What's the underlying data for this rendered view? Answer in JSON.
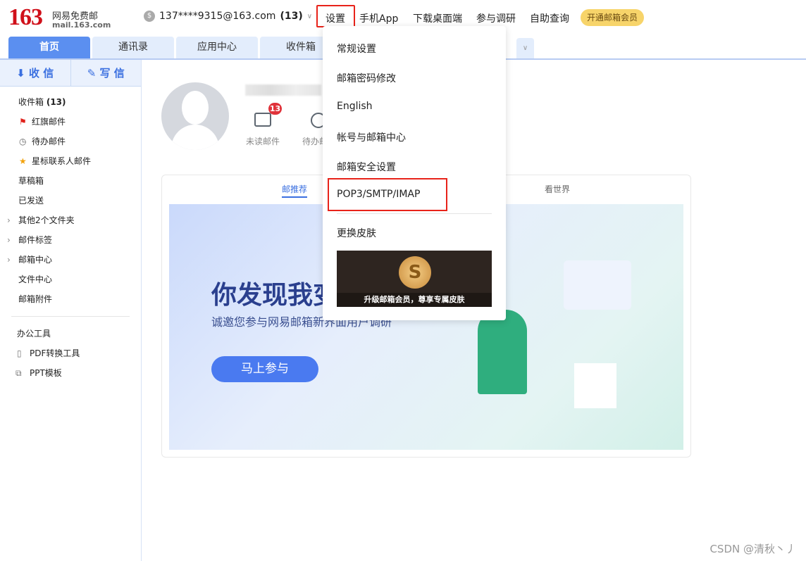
{
  "header": {
    "logo_number": "163",
    "logo_cn": "网易免费邮",
    "logo_domain": "mail.163.com",
    "account": "137****9315@163.com",
    "unread_count": "(13)",
    "nav": [
      "设置",
      "手机App",
      "下载桌面端",
      "参与调研",
      "自助查询"
    ],
    "vip_button": "开通邮箱会员"
  },
  "tabs": [
    "首页",
    "通讯录",
    "应用中心",
    "收件箱"
  ],
  "sidebar": {
    "receive": "收 信",
    "compose": "写 信",
    "folders": [
      {
        "label": "收件箱",
        "count": "(13)"
      },
      {
        "label": "红旗邮件"
      },
      {
        "label": "待办邮件"
      },
      {
        "label": "星标联系人邮件"
      },
      {
        "label": "草稿箱"
      },
      {
        "label": "已发送"
      },
      {
        "label": "其他2个文件夹"
      },
      {
        "label": "邮件标签"
      },
      {
        "label": "邮箱中心"
      },
      {
        "label": "文件中心"
      },
      {
        "label": "邮箱附件"
      }
    ],
    "tools_title": "办公工具",
    "tools": [
      "PDF转换工具",
      "PPT模板"
    ]
  },
  "profile": {
    "unread_badge": "13",
    "unread_label": "未读邮件",
    "todo_label": "待办邮件"
  },
  "card": {
    "tabs": [
      "邮推荐",
      "看世界"
    ],
    "headline": "你发现我变了吗",
    "subtitle": "诚邀您参与网易邮箱新界面用户调研",
    "join_button": "马上参与"
  },
  "settings_menu": {
    "items": [
      "常规设置",
      "邮箱密码修改",
      "English",
      "帐号与邮箱中心",
      "邮箱安全设置",
      "POP3/SMTP/IMAP",
      "更换皮肤"
    ],
    "skin_caption": "升级邮箱会员，尊享专属皮肤"
  },
  "watermark": "CSDN @清秋丶丿",
  "colors": {
    "brand_red": "#d0101a",
    "accent_blue": "#3a6fe0",
    "highlight_red": "#e8231a"
  }
}
